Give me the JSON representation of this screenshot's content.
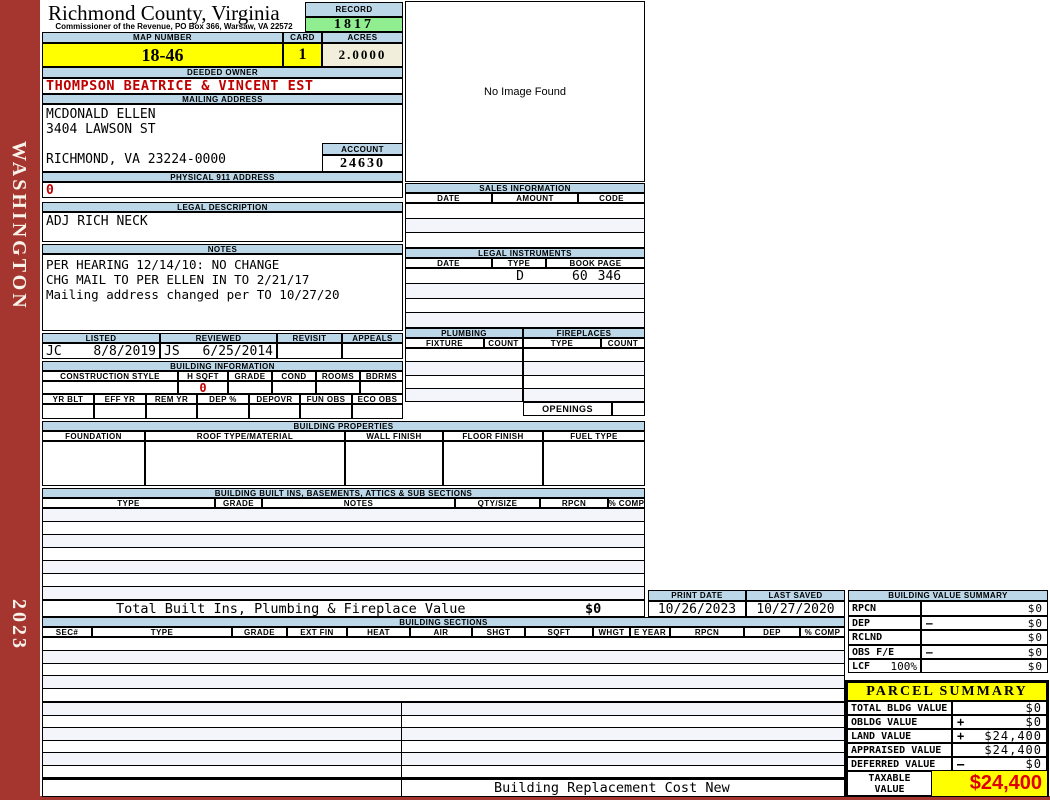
{
  "colors": {
    "header_bar_blue": "#BCD8E8",
    "record_green": "#90EE90",
    "highlight_yellow": "#FFFF00",
    "acres_beige": "#F1EFDC",
    "sidebar_red": "#A5362F",
    "alert_red": "#C00000",
    "taxable_red": "#E10000",
    "row_stripe": "#F4F4FB"
  },
  "sidebar": {
    "district": "WASHINGTON",
    "year": "2023"
  },
  "header": {
    "county": "Richmond County, Virginia",
    "commissioner_line": "Commissioner of the Revenue, PO Box 366, Warsaw, VA 22572",
    "record_label": "RECORD",
    "record_value": "1817",
    "map_number_label": "MAP NUMBER",
    "map_number_value": "18-46",
    "card_label": "CARD",
    "card_value": "1",
    "acres_label": "ACRES",
    "acres_value": "2.0000"
  },
  "owner": {
    "label": "DEEDED OWNER",
    "name": "THOMPSON BEATRICE & VINCENT EST"
  },
  "mailing": {
    "label": "MAILING ADDRESS",
    "lines": [
      "MCDONALD ELLEN",
      "3404 LAWSON ST",
      "",
      "RICHMOND, VA 23224-0000"
    ]
  },
  "account": {
    "label": "ACCOUNT",
    "value": "24630"
  },
  "physical911": {
    "label": "PHYSICAL 911 ADDRESS",
    "value": "0"
  },
  "legal_description": {
    "label": "LEGAL DESCRIPTION",
    "value": "ADJ RICH NECK"
  },
  "notes": {
    "label": "NOTES",
    "lines": [
      "PER HEARING 12/14/10: NO CHANGE",
      "CHG MAIL TO PER ELLEN IN TO 2/21/17",
      "Mailing address changed per TO 10/27/20"
    ]
  },
  "review": {
    "headers": [
      "LISTED",
      "REVIEWED",
      "REVISIT",
      "APPEALS"
    ],
    "listed_by": "JC",
    "listed_date": "8/8/2019",
    "reviewed_by": "JS",
    "reviewed_date": "6/25/2014",
    "revisit": "",
    "appeals": ""
  },
  "image_panel": {
    "placeholder": "No Image Found"
  },
  "sales": {
    "title": "SALES INFORMATION",
    "headers": [
      "DATE",
      "AMOUNT",
      "CODE"
    ]
  },
  "legal_instruments": {
    "title": "LEGAL INSTRUMENTS",
    "headers": [
      "DATE",
      "TYPE",
      "BOOK PAGE"
    ],
    "first_row": {
      "date": "",
      "type": "D",
      "book": "60",
      "page": "346"
    }
  },
  "plumbing": {
    "title": "PLUMBING",
    "headers": [
      "FIXTURE",
      "COUNT"
    ]
  },
  "fireplaces": {
    "title": "FIREPLACES",
    "headers": [
      "TYPE",
      "COUNT"
    ],
    "openings_label": "OPENINGS"
  },
  "building_information": {
    "title": "BUILDING INFORMATION",
    "row1_headers": [
      "CONSTRUCTION STYLE",
      "H SQFT",
      "GRADE",
      "COND",
      "ROOMS",
      "BDRMS"
    ],
    "h_sqft_value": "0",
    "row2_headers": [
      "YR BLT",
      "EFF YR",
      "REM YR",
      "DEP %",
      "DEPOVR",
      "FUN OBS",
      "ECO OBS"
    ]
  },
  "building_properties": {
    "title": "BUILDING PROPERTIES",
    "headers": [
      "FOUNDATION",
      "ROOF TYPE/MATERIAL",
      "WALL FINISH",
      "FLOOR FINISH",
      "FUEL TYPE"
    ]
  },
  "built_ins": {
    "title": "BUILDING BUILT INS, BASEMENTS, ATTICS & SUB SECTIONS",
    "headers": [
      "TYPE",
      "GRADE",
      "NOTES",
      "QTY/SIZE",
      "RPCN",
      "% COMP"
    ],
    "total_label": "Total Built Ins, Plumbing & Fireplace Value",
    "total_value": "$0"
  },
  "building_sections": {
    "title": "BUILDING SECTIONS",
    "headers": [
      "SEC#",
      "TYPE",
      "GRADE",
      "EXT FIN",
      "HEAT",
      "AIR",
      "SHGT",
      "SQFT",
      "WHGT",
      "E YEAR",
      "RPCN",
      "DEP",
      "% COMP"
    ],
    "footer_label": "Building Replacement Cost New"
  },
  "print_info": {
    "print_date_label": "PRINT DATE",
    "print_date_value": "10/26/2023",
    "last_saved_label": "LAST SAVED",
    "last_saved_value": "10/27/2020"
  },
  "building_value_summary": {
    "title": "BUILDING VALUE SUMMARY",
    "rows": [
      {
        "label": "RPCN",
        "sign": "",
        "value": "$0"
      },
      {
        "label": "DEP",
        "sign": "–",
        "value": "$0"
      },
      {
        "label": "RCLND",
        "sign": "",
        "value": "$0"
      },
      {
        "label": "OBS F/E",
        "sign": "–",
        "value": "$0"
      },
      {
        "label": "LCF",
        "pct": "100%",
        "sign": "",
        "value": "$0"
      }
    ]
  },
  "parcel_summary": {
    "title": "PARCEL SUMMARY",
    "rows": [
      {
        "label": "TOTAL BLDG VALUE",
        "sign": "",
        "value": "$0"
      },
      {
        "label": "OBLDG VALUE",
        "sign": "+",
        "value": "$0"
      },
      {
        "label": "LAND VALUE",
        "sign": "+",
        "value": "$24,400"
      },
      {
        "label": "APPRAISED VALUE",
        "sign": "",
        "value": "$24,400"
      },
      {
        "label": "DEFERRED VALUE",
        "sign": "–",
        "value": "$0"
      }
    ],
    "taxable_label_line1": "TAXABLE",
    "taxable_label_line2": "VALUE",
    "taxable_value": "$24,400"
  }
}
